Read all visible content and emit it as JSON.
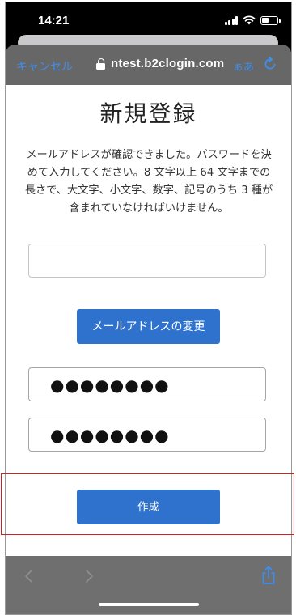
{
  "status_bar": {
    "time": "14:21"
  },
  "nav_bar": {
    "cancel_label": "キャンセル",
    "url": "ntest.b2clogin.com",
    "text_size_label": "ぁあ",
    "lock_icon": "lock-icon",
    "reload_icon": "reload-icon"
  },
  "page": {
    "title": "新規登録",
    "instructions": "メールアドレスが確認できました。パスワードを決めて入力してください。8 文字以上 64 文字までの長さで、大文字、小文字、数字、記号のうち 3 種が含まれていなければいけません。",
    "email_value": "",
    "change_email_label": "メールアドレスの変更",
    "password_value": "●●●●●●●●",
    "confirm_password_value": "●●●●●●●●",
    "create_label": "作成"
  },
  "toolbar": {
    "back_icon": "chevron-left-icon",
    "forward_icon": "chevron-right-icon",
    "share_icon": "share-icon"
  },
  "colors": {
    "accent": "#2f72cd",
    "link": "#3d8ef0",
    "highlight": "#d21f1f",
    "nav_bar": "#676767"
  }
}
